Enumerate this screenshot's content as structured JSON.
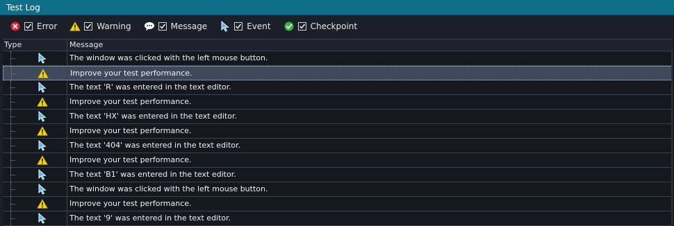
{
  "panel": {
    "title": "Test Log"
  },
  "filters": [
    {
      "icon": "error-icon",
      "label": "Error",
      "checked": true
    },
    {
      "icon": "warning-icon",
      "label": "Warning",
      "checked": true
    },
    {
      "icon": "message-icon",
      "label": "Message",
      "checked": true
    },
    {
      "icon": "event-icon",
      "label": "Event",
      "checked": true
    },
    {
      "icon": "checkpoint-icon",
      "label": "Checkpoint",
      "checked": true
    }
  ],
  "columns": {
    "type": "Type",
    "message": "Message"
  },
  "rows": [
    {
      "type": "event",
      "message": "The window was clicked with the left mouse button."
    },
    {
      "type": "warning",
      "message": "Improve your test performance.",
      "selected": true
    },
    {
      "type": "event",
      "message": "The text 'R' was entered in the text editor."
    },
    {
      "type": "warning",
      "message": "Improve your test performance."
    },
    {
      "type": "event",
      "message": "The text 'HX' was entered in the text editor."
    },
    {
      "type": "warning",
      "message": "Improve your test performance."
    },
    {
      "type": "event",
      "message": "The text '404' was entered in the text editor."
    },
    {
      "type": "warning",
      "message": "Improve your test performance."
    },
    {
      "type": "event",
      "message": "The text 'B1' was entered in the text editor."
    },
    {
      "type": "event",
      "message": "The window was clicked with the left mouse button."
    },
    {
      "type": "warning",
      "message": "Improve your test performance."
    },
    {
      "type": "event",
      "message": "The text '9' was entered in the text editor."
    }
  ],
  "colors": {
    "title_bar": "#0f6f8a",
    "background": "#1b1f2a",
    "selected_row": "#3e4a5c",
    "error": "#e0242f",
    "warning": "#f2d20a",
    "checkpoint": "#3cb043",
    "event": "#59b9ef"
  }
}
